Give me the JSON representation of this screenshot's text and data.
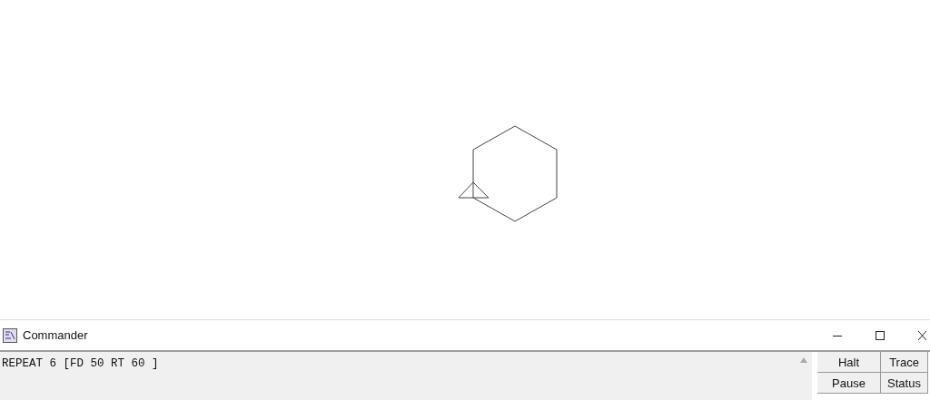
{
  "graphics": {
    "kind": "turtle"
  },
  "commander": {
    "title": "Commander",
    "input": "REPEAT 6 [FD 50 RT 60 ]",
    "buttons": [
      {
        "label": "Halt"
      },
      {
        "label": "Trace"
      },
      {
        "label": "Pause"
      },
      {
        "label": "Status"
      }
    ]
  }
}
